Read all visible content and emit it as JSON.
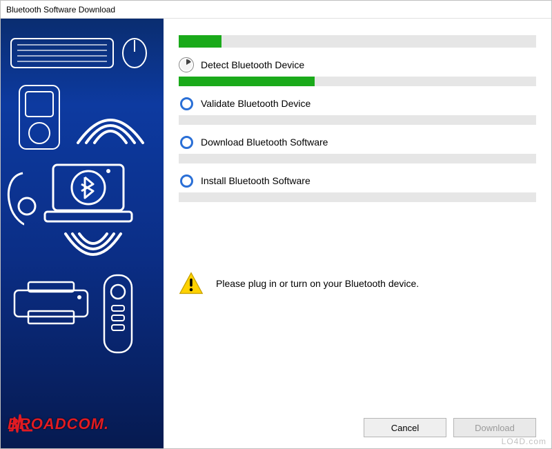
{
  "window": {
    "title": "Bluetooth Software Download"
  },
  "overall_progress": {
    "percent": 12
  },
  "steps": [
    {
      "label": "Detect Bluetooth Device",
      "status": "active",
      "percent": 38
    },
    {
      "label": "Validate Bluetooth Device",
      "status": "pending",
      "percent": 0
    },
    {
      "label": "Download Bluetooth Software",
      "status": "pending",
      "percent": 0
    },
    {
      "label": "Install Bluetooth Software",
      "status": "pending",
      "percent": 0
    }
  ],
  "message": "Please plug in or turn on your Bluetooth device.",
  "buttons": {
    "cancel": "Cancel",
    "download": "Download"
  },
  "brand": "BROADCOM.",
  "watermark": "LO4D.com",
  "colors": {
    "progress_fill": "#1aaa1a",
    "ring": "#2a6fd6",
    "brand_red": "#e11b22"
  }
}
